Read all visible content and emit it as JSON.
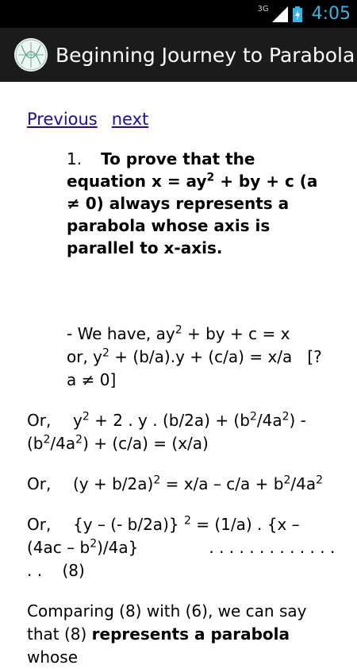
{
  "status_bar": {
    "network": "3G",
    "time": "4:05"
  },
  "action_bar": {
    "title": "Beginning Journey to Parabola"
  },
  "nav": {
    "previous": "Previous",
    "next": "next"
  },
  "statement": {
    "number": "1.",
    "part1": "To prove that the equation x = ay",
    "exp1": "2",
    "part2": " + by + c (a ≠ 0) always represents a parabola whose axis is parallel to x-axis."
  },
  "step0": {
    "a": "- We have, ay",
    "exp": "2",
    "b": " + by + c = x       or, y",
    "exp2": "2",
    "c": " + (b/a).y + (c/a) = x/a   [? a ≠ 0]"
  },
  "step1": {
    "label": "Or,",
    "a": "y",
    "e1": "2",
    "b": " + 2 . y . (b/2a) + (b",
    "e2": "2",
    "c": "/4a",
    "e3": "2",
    "d": ") - (b",
    "e4": "2",
    "e": "/4a",
    "e5": "2",
    "f": ") + (c/a) = (x/a)"
  },
  "step2": {
    "label": "Or,",
    "a": "(y + b/2a)",
    "e1": "2",
    "b": " = x/a – c/a + b",
    "e2": "2",
    "c": "/4a",
    "e3": "2"
  },
  "step3": {
    "label": "Or,",
    "a": "{y – (- b/2a)} ",
    "e1": "2",
    "b": " = (1/a) . {x – (4ac – b",
    "e2": "2",
    "c": ")/4a}              . . . . . . . . . . . . . . .    (8)"
  },
  "conclusion": {
    "a": "Comparing (8) with (6), we can say that (8) ",
    "bold": "represents a parabola",
    "b": " whose"
  }
}
